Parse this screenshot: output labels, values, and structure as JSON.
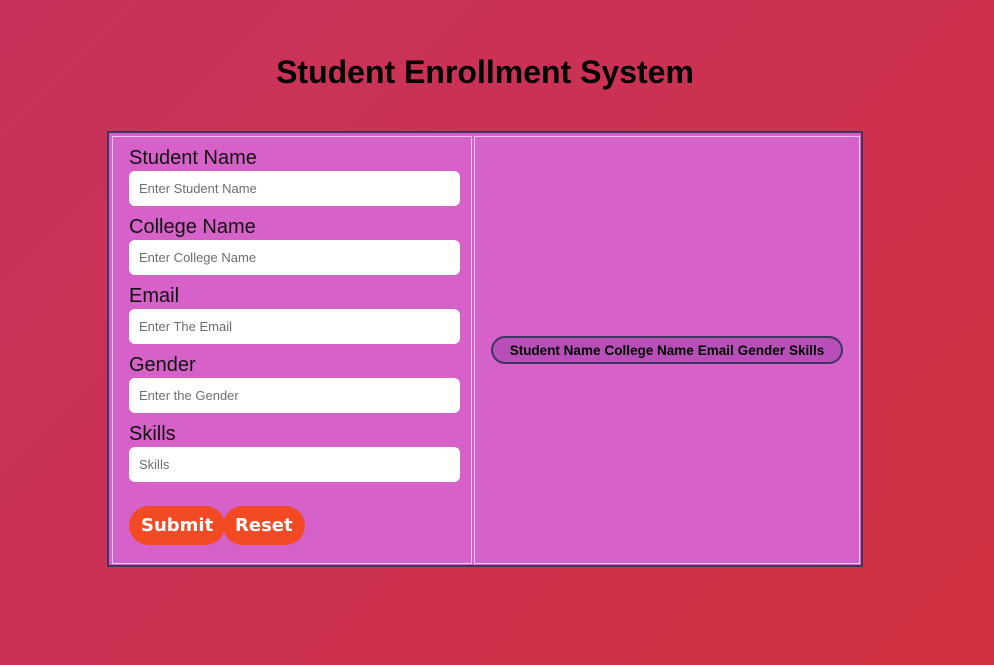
{
  "title": "Student Enrollment System",
  "form": {
    "fields": [
      {
        "label": "Student Name",
        "placeholder": "Enter Student Name",
        "value": ""
      },
      {
        "label": "College Name",
        "placeholder": "Enter College Name",
        "value": ""
      },
      {
        "label": "Email",
        "placeholder": "Enter The Email",
        "value": ""
      },
      {
        "label": "Gender",
        "placeholder": "Enter the Gender",
        "value": ""
      },
      {
        "label": "Skills",
        "placeholder": "Skills",
        "value": ""
      }
    ],
    "submit_label": "Submit",
    "reset_label": "Reset"
  },
  "table": {
    "columns": [
      "Student Name",
      "College Name",
      "Email",
      "Gender",
      "Skills"
    ]
  },
  "colors": {
    "background": "#cc3152",
    "panel": "#d662c9",
    "button": "#f24a25"
  }
}
